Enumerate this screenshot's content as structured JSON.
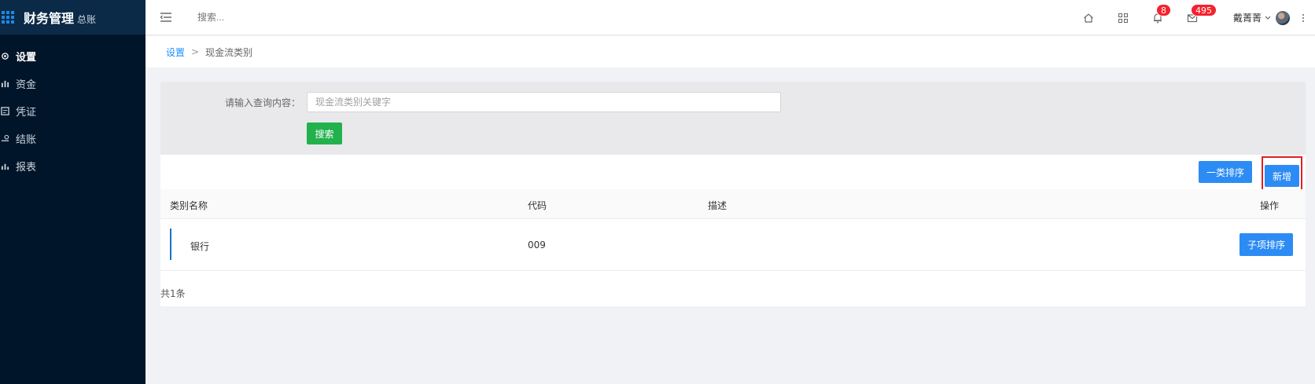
{
  "sidebar": {
    "brand_title": "财务管理",
    "brand_sub": "总账",
    "items": [
      {
        "label": "设置",
        "icon": "gear-icon",
        "active": true
      },
      {
        "label": "资金",
        "icon": "funds-icon",
        "active": false
      },
      {
        "label": "凭证",
        "icon": "voucher-icon",
        "active": false
      },
      {
        "label": "结账",
        "icon": "checkout-icon",
        "active": false
      },
      {
        "label": "报表",
        "icon": "chart-icon",
        "active": false
      }
    ]
  },
  "header": {
    "search_placeholder": "搜索...",
    "notification_count": "8",
    "message_count": "495",
    "user_name": "戴菁菁"
  },
  "breadcrumb": {
    "root": "设置",
    "separator": ">",
    "current": "现金流类别"
  },
  "search": {
    "label": "请输入查询内容：",
    "placeholder": "现金流类别关键字",
    "button": "搜索"
  },
  "toolbar": {
    "sort_label": "一类排序",
    "add_label": "新增"
  },
  "table": {
    "columns": {
      "name": "类别名称",
      "code": "代码",
      "desc": "描述",
      "action": "操作"
    },
    "rows": [
      {
        "name": "银行",
        "code": "009",
        "desc": "",
        "action": "子项排序"
      }
    ],
    "total": "共1条"
  },
  "colors": {
    "sidebar_bg": "#001529",
    "primary": "#2c8cf4",
    "search_button": "#22b14c",
    "badge": "#f5222d",
    "highlight_box": "#e02020"
  }
}
